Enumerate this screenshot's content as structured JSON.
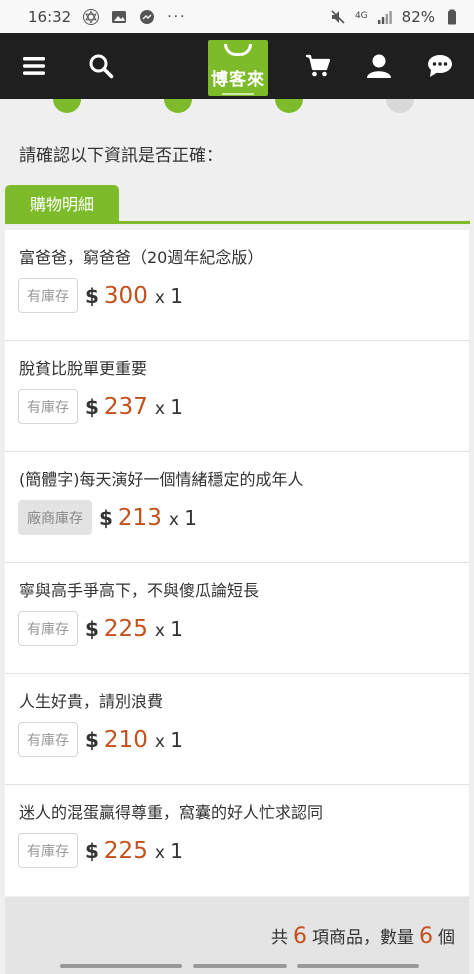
{
  "status_bar": {
    "time": "16:32",
    "network": "4G",
    "battery": "82%"
  },
  "navbar": {
    "logo_text": "博客來",
    "icons": [
      "menu-icon",
      "search-icon",
      "cart-icon",
      "user-icon",
      "chat-icon"
    ]
  },
  "prompt": "請確認以下資訊是否正確：",
  "tab_label": "購物明細",
  "currency": "$",
  "times": "x",
  "items": [
    {
      "title": "富爸爸，窮爸爸（20週年紀念版）",
      "stock": "有庫存",
      "price": "300",
      "qty": "1"
    },
    {
      "title": "脫貧比脫單更重要",
      "stock": "有庫存",
      "price": "237",
      "qty": "1"
    },
    {
      "title": "(簡體字)每天演好一個情緒穩定的成年人",
      "stock": "廠商庫存",
      "price": "213",
      "qty": "1"
    },
    {
      "title": "寧與高手爭高下，不與傻瓜論短長",
      "stock": "有庫存",
      "price": "225",
      "qty": "1"
    },
    {
      "title": "人生好貴，請別浪費",
      "stock": "有庫存",
      "price": "210",
      "qty": "1"
    },
    {
      "title": "迷人的混蛋贏得尊重，窩囊的好人忙求認同",
      "stock": "有庫存",
      "price": "225",
      "qty": "1"
    }
  ],
  "summary": {
    "prefix": "共",
    "item_count": "6",
    "middle": "項商品，數量",
    "quantity": "6",
    "suffix": "個"
  },
  "colors": {
    "brand_green": "#7dbb2a",
    "price_orange": "#c4501c",
    "navbar": "#1f1f1f"
  }
}
